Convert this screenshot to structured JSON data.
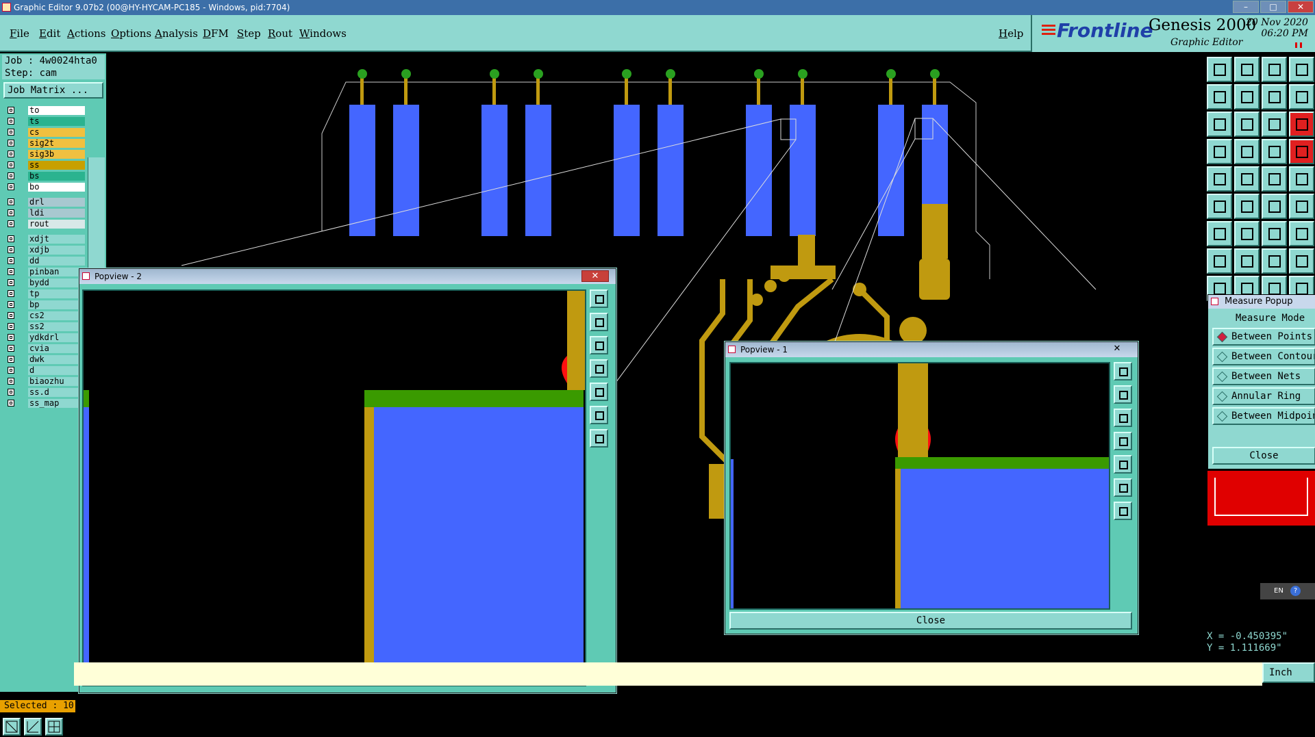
{
  "window": {
    "title": "Graphic Editor 9.07b2 (00@HY-HYCAM-PC185 - Windows, pid:7704)",
    "min_label": "–",
    "max_label": "□",
    "close_label": "✕"
  },
  "menu": {
    "items": [
      "File",
      "Edit",
      "Actions",
      "Options",
      "Analysis",
      "DFM",
      "Step",
      "Rout",
      "Windows"
    ],
    "help": "Help"
  },
  "brand": {
    "logo": "Frontline",
    "product": "Genesis 2000",
    "subtitle": "Graphic Editor",
    "date": "20 Nov 2020",
    "time": "06:20 PM"
  },
  "left_panel": {
    "job": "Job : 4w0024hta0",
    "step": "Step: cam",
    "job_matrix": "Job Matrix ...",
    "layers": [
      {
        "name": "to",
        "color": "#ffffff"
      },
      {
        "name": "ts",
        "color": "#2bb38f"
      },
      {
        "name": "cs",
        "color": "#f0c040"
      },
      {
        "name": "sig2t",
        "color": "#f0c040"
      },
      {
        "name": "sig3b",
        "color": "#f0c040"
      },
      {
        "name": "ss",
        "color": "#c8a000"
      },
      {
        "name": "bs",
        "color": "#2bb38f"
      },
      {
        "name": "bo",
        "color": "#ffffff"
      },
      {
        "name": "drl",
        "color": "#a8c8d0"
      },
      {
        "name": "ldi",
        "color": "#a8c8d0"
      },
      {
        "name": "rout",
        "color": "#d8e8e8"
      },
      {
        "name": "xdjt",
        "color": "#8fd8d0"
      },
      {
        "name": "xdjb",
        "color": "#8fd8d0"
      },
      {
        "name": "dd",
        "color": "#8fd8d0"
      },
      {
        "name": "pinban",
        "color": "#8fd8d0"
      },
      {
        "name": "bydd",
        "color": "#8fd8d0"
      },
      {
        "name": "tp",
        "color": "#8fd8d0"
      },
      {
        "name": "bp",
        "color": "#8fd8d0"
      },
      {
        "name": "cs2",
        "color": "#8fd8d0"
      },
      {
        "name": "ss2",
        "color": "#8fd8d0"
      },
      {
        "name": "ydkdrl",
        "color": "#8fd8d0"
      },
      {
        "name": "cvia",
        "color": "#8fd8d0"
      },
      {
        "name": "dwk",
        "color": "#8fd8d0"
      },
      {
        "name": "d",
        "color": "#8fd8d0"
      },
      {
        "name": "biaozhu",
        "color": "#8fd8d0"
      },
      {
        "name": "ss.d",
        "color": "#8fd8d0"
      },
      {
        "name": "ss_map",
        "color": "#8fd8d0"
      }
    ],
    "selected": "Selected : 10"
  },
  "measure_popup": {
    "title": "Measure Popup",
    "mode_label": "Measure Mode",
    "options": [
      "Between Points",
      "Between Contours",
      "Between Nets",
      "Annular Ring",
      "Between Midpoints"
    ],
    "close": "Close"
  },
  "popview1": {
    "title": "Popview - 1",
    "close": "Close",
    "close_x": "✕"
  },
  "popview2": {
    "title": "Popview - 2",
    "close_x": "✕"
  },
  "coords": {
    "x": "X = -0.450395\"",
    "y": "Y = 1.111669\""
  },
  "status": {
    "units": "Inch",
    "lang": "EN",
    "help": "?"
  },
  "colors": {
    "pad_blue": "#4466ff",
    "copper": "#c09a10",
    "mask_green": "#3a9a00",
    "via_green": "#2aa020",
    "highlight_red": "#ff1010",
    "panel_teal": "#8fd8d0"
  },
  "icons": [
    "window-icon",
    "frontline-logo",
    "zoom-tool-icon",
    "measure-tool-icon",
    "grid-tool-icon"
  ]
}
